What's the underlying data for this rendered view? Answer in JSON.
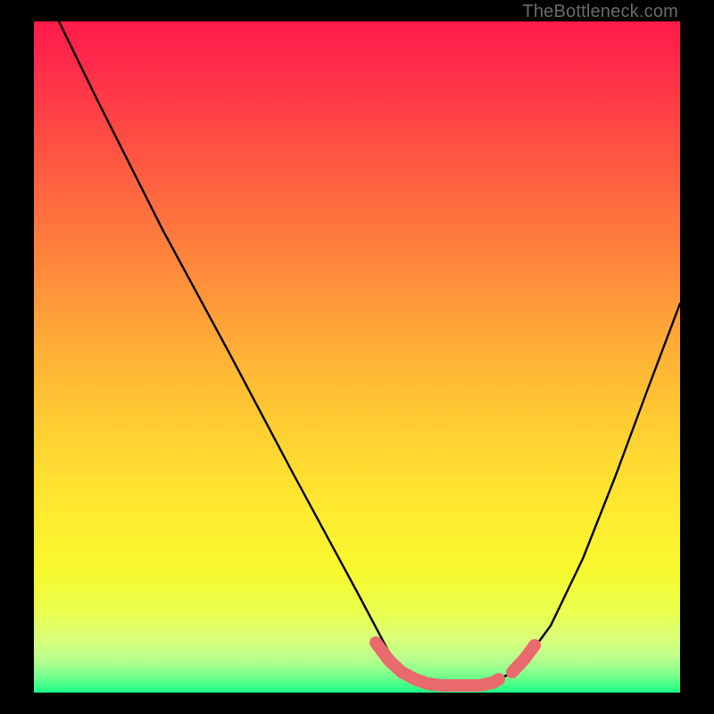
{
  "watermark": "TheBottleneck.com",
  "chart_data": {
    "type": "line",
    "title": "",
    "xlabel": "",
    "ylabel": "",
    "xlim": [
      0,
      100
    ],
    "ylim": [
      0,
      100
    ],
    "series": [
      {
        "name": "curve",
        "x": [
          4,
          10,
          20,
          30,
          40,
          50,
          55,
          58,
          60,
          63,
          67,
          70,
          72,
          75,
          80,
          85,
          90,
          95,
          100
        ],
        "values": [
          100,
          88,
          69,
          51,
          33,
          15,
          6,
          2.5,
          1.5,
          1,
          1,
          1.2,
          2,
          3.5,
          10,
          20,
          32,
          45,
          58
        ]
      },
      {
        "name": "highlight",
        "x": [
          53,
          55,
          57,
          59,
          61,
          63,
          65,
          67,
          69,
          71,
          72,
          74,
          76,
          77.5
        ],
        "values": [
          7.5,
          4.8,
          3,
          2,
          1.3,
          1,
          1,
          1,
          1.1,
          1.4,
          2,
          3,
          5,
          7
        ]
      }
    ],
    "colors": {
      "curve": "#000000",
      "highlight": "#e96a6c",
      "gradient_top": "#ff1b4a",
      "gradient_bottom": "#1aff84"
    }
  }
}
